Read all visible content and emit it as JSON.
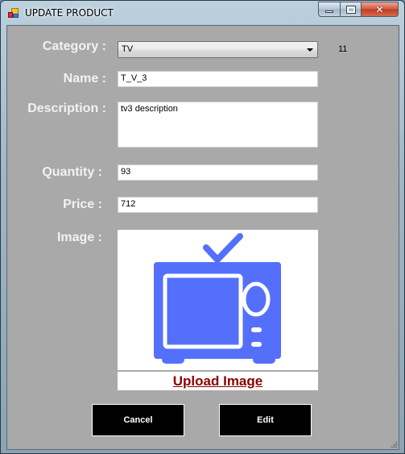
{
  "window": {
    "title": "UPDATE PRODUCT",
    "controls": {
      "minimize": "minimize",
      "maximize": "maximize",
      "close": "✕"
    }
  },
  "form": {
    "category": {
      "label": "Category :",
      "value": "TV",
      "id_display": "11"
    },
    "name": {
      "label": "Name :",
      "value": "T_V_3"
    },
    "description": {
      "label": "Description :",
      "value": "tv3 description"
    },
    "quantity": {
      "label": "Quantity :",
      "value": "93"
    },
    "price": {
      "label": "Price :",
      "value": "712"
    },
    "image": {
      "label": "Image :",
      "icon": "tv-icon",
      "icon_color": "#5470fb",
      "upload_label": "Upload Image"
    }
  },
  "buttons": {
    "cancel": "Cancel",
    "edit": "Edit"
  },
  "colors": {
    "background": "#a9a9a9",
    "button_bg": "#000000",
    "upload_link": "#8b0000"
  }
}
